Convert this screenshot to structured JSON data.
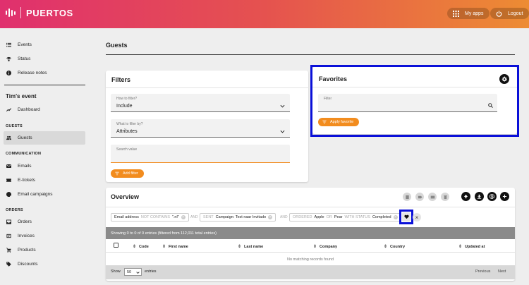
{
  "header": {
    "app_name": "PUERTOS",
    "my_apps_label": "My apps",
    "logout_label": "Logout"
  },
  "sidebar": {
    "top_items": [
      {
        "label": "Events",
        "icon": "list-icon"
      },
      {
        "label": "Status",
        "icon": "wifi-icon"
      },
      {
        "label": "Release notes",
        "icon": "info-icon"
      }
    ],
    "event_name": "Tim's event",
    "dashboard_label": "Dashboard",
    "guests_heading": "GUESTS",
    "guests_label": "Guests",
    "communication_heading": "COMMUNICATION",
    "communication_items": [
      {
        "label": "Emails",
        "icon": "mail-icon"
      },
      {
        "label": "E-tickets",
        "icon": "ticket-icon"
      },
      {
        "label": "Email campaigns",
        "icon": "at-icon"
      }
    ],
    "orders_heading": "ORDERS",
    "orders_items": [
      {
        "label": "Orders",
        "icon": "inbox-icon"
      },
      {
        "label": "Invoices",
        "icon": "invoice-icon"
      },
      {
        "label": "Products",
        "icon": "cart-icon"
      },
      {
        "label": "Discounts",
        "icon": "tag-icon"
      }
    ]
  },
  "page": {
    "title": "Guests"
  },
  "filters": {
    "title": "Filters",
    "how_label": "How to filter?",
    "how_value": "Include",
    "what_label": "What to filter by?",
    "what_value": "Attributes",
    "search_placeholder": "Search value",
    "add_filter_label": "Add filter"
  },
  "favorites": {
    "title": "Favorites",
    "filter_label": "Filter",
    "apply_label": "Apply favorite"
  },
  "overview": {
    "title": "Overview",
    "chips": {
      "c1_key": "Email address",
      "c1_op": "NOT CONTAINS",
      "c1_val": "\".nl\"",
      "and1": "AND",
      "c2_key": "SENT",
      "c2_val": "Campaign: Test naar Invitado",
      "and2": "AND",
      "c3_key": "ORDERED",
      "c3_v1": "Apple",
      "c3_or": "OR",
      "c3_v2": "Pear",
      "c3_status_key": "WITH STATUS",
      "c3_status_val": "Completed"
    },
    "info": "Showing 0 to 0 of 0 entries (filtered from 112,011 total entries)",
    "columns": {
      "code": "Code",
      "first_name": "First name",
      "last_name": "Last name",
      "company": "Company",
      "country": "Country",
      "updated_at": "Updated at"
    },
    "empty_message": "No matching records found",
    "show_label": "Show",
    "page_size": "50",
    "entries_label": "entries",
    "previous_label": "Previous",
    "next_label": "Next"
  },
  "colors": {
    "accent": "#f28c1e",
    "highlight": "#0a10d8",
    "header_gradient_start": "#e0306e",
    "header_gradient_end": "#ed8c33"
  }
}
